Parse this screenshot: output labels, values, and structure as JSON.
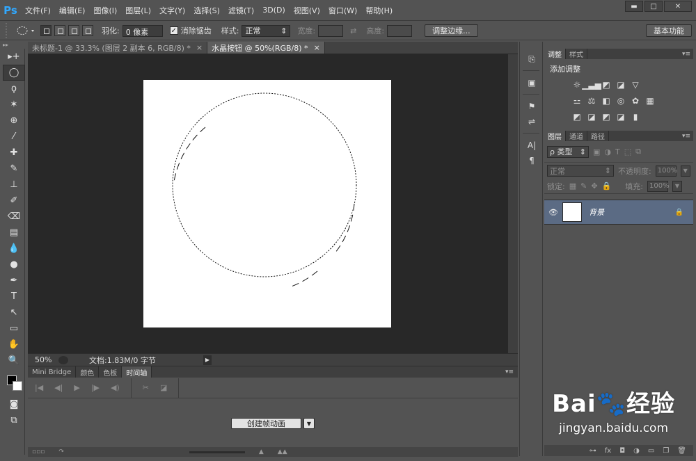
{
  "app": {
    "logo": "Ps",
    "menu": [
      "文件(F)",
      "编辑(E)",
      "图像(I)",
      "图层(L)",
      "文字(Y)",
      "选择(S)",
      "滤镜(T)",
      "3D(D)",
      "视图(V)",
      "窗口(W)",
      "帮助(H)"
    ],
    "window_controls": [
      "▬",
      "□",
      "✕"
    ]
  },
  "options_bar": {
    "feather_label": "羽化:",
    "feather_value": "0 像素",
    "antialias_checked": "✓",
    "antialias_label": "消除锯齿",
    "style_label": "样式:",
    "style_value": "正常",
    "width_label": "宽度:",
    "swap_icon": "⇄",
    "height_label": "高度:",
    "refine_edge": "调整边缘...",
    "workspace": "基本功能"
  },
  "tools": [
    "▸+",
    "◯",
    "ϙ",
    "✶",
    "⊕",
    "⁄",
    "✚",
    "✎",
    "⊥",
    "✐",
    "⌫",
    "▤",
    "💧",
    "●",
    "✒",
    "T",
    "↖",
    "▭",
    "✋",
    "🔍"
  ],
  "doc_tabs": [
    {
      "label": "未标题-1 @ 33.3% (图层 2 副本 6, RGB/8) *",
      "close": "×"
    },
    {
      "label": "水晶按钮 @ 50%(RGB/8) *",
      "close": "×"
    }
  ],
  "status": {
    "zoom": "50%",
    "info": "文档:1.83M/0 字节",
    "arrow": "▶"
  },
  "bottom_panel": {
    "tabs": [
      "Mini Bridge",
      "颜色",
      "色板",
      "时间轴"
    ],
    "menu_icon": "▾≡",
    "controls": [
      "|◀",
      "◀|",
      "▶",
      "|▶",
      "◀)",
      "✂",
      "◪"
    ],
    "create_button": "创建帧动画",
    "create_drop": "▼",
    "footer_icons": [
      "▫▫▫",
      "↷",
      "▲",
      "▲▲"
    ]
  },
  "mid_dock": {
    "icons": [
      "⎘",
      "▣",
      "⚑",
      "⇌",
      "A|",
      "¶"
    ]
  },
  "right_panel": {
    "adj_tabs": [
      "调整",
      "样式"
    ],
    "menu_icon": "▾≡",
    "adj_title": "添加调整",
    "adj_rows": [
      [
        "☼",
        "▁▃▅",
        "◩",
        "◪",
        "▽"
      ],
      [
        "⚍",
        "⚖",
        "◧",
        "◎",
        "✿",
        "▦"
      ],
      [
        "◩",
        "◪",
        "◩",
        "◪",
        "▮"
      ]
    ],
    "layers_tabs": [
      "图层",
      "通道",
      "路径"
    ],
    "kind_label": "ρ 类型",
    "filter_icons": [
      "▣",
      "◑",
      "T",
      "⬚",
      "⧉"
    ],
    "blend_mode": "正常",
    "opacity_label": "不透明度:",
    "opacity_value": "100%",
    "lock_label": "锁定:",
    "lock_icons": [
      "▦",
      "✎",
      "✥",
      "🔒"
    ],
    "fill_label": "填充:",
    "fill_value": "100%",
    "layer": {
      "eye": "👁",
      "name": "背景",
      "lock": "🔒"
    },
    "footer_icons": [
      "⊶",
      "fx",
      "◘",
      "◑",
      "▭",
      "❐",
      "🗑"
    ]
  },
  "watermark": {
    "logo": "Bai🐾经验",
    "url": "jingyan.baidu.com"
  },
  "colors": {
    "ui_bg": "#535353",
    "canvas_bg": "#282828",
    "selected_layer": "#5b6b84",
    "document": "#ffffff"
  }
}
